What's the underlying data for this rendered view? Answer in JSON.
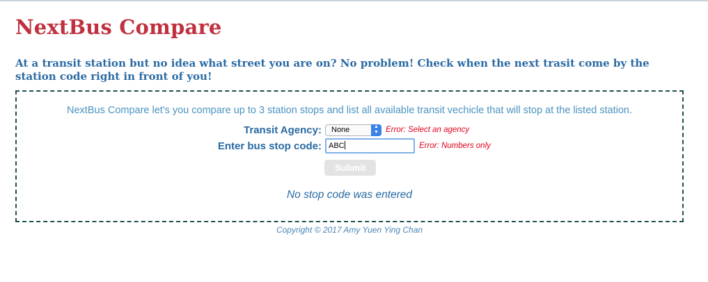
{
  "header": {
    "title": "NextBus Compare",
    "tagline": "At a transit station but no idea what street you are on? No problem! Check when the next trasit come by the station code right in front of you!"
  },
  "panel": {
    "intro": "NextBus Compare let's you compare up to 3 station stops and list all available transit vechicle that will stop at the listed station."
  },
  "form": {
    "agency_label": "Transit Agency:",
    "agency_selected": "None",
    "agency_error": "Error: Select an agency",
    "stop_label": "Enter bus stop code:",
    "stop_value": "ABC",
    "stop_error": "Error: Numbers only",
    "submit_label": "Submit",
    "submit_enabled": false
  },
  "status": {
    "message": "No stop code was entered"
  },
  "footer": {
    "copyright": "Copyright © 2017 Amy Yuen Ying Chan"
  },
  "colors": {
    "title": "#c0313f",
    "heading": "#2a6aa3",
    "intro_text": "#4a93c0",
    "error": "#e0001b",
    "panel_border": "#1f4e4d"
  }
}
